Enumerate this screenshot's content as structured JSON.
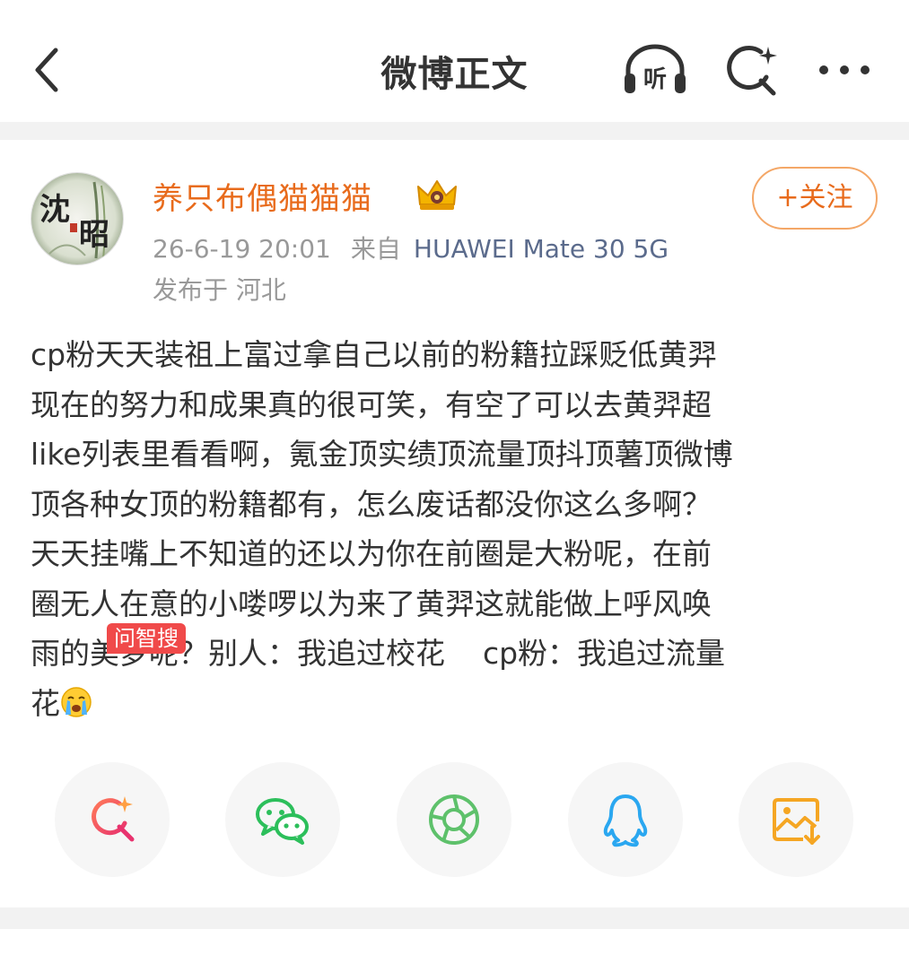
{
  "nav": {
    "title": "微博正文",
    "listen_label": "听",
    "icons": [
      "back-arrow-icon",
      "listen-headphones-icon",
      "ai-search-icon",
      "more-dots-icon"
    ]
  },
  "post": {
    "username": "养只布偶猫猫猫",
    "time": "26-6-19 20:01",
    "from_label": "来自",
    "device": "HUAWEI Mate 30 5G",
    "location": "发布于 河北",
    "follow_label": "+关注",
    "avatar_text": "沈 昭",
    "lines": [
      "cp粉天天装祖上富过拿自己以前的粉籍拉踩贬低黄羿",
      "现在的努力和成果真的很可笑，有空了可以去黄羿超",
      "like列表里看看啊，氪金顶实绩顶流量顶抖顶薯顶微博",
      "顶各种女顶的粉籍都有，怎么废话都没你这么多啊？",
      "天天挂嘴上不知道的还以为你在前圈是大粉呢，在前",
      "圈无人在意的小喽啰以为来了黄羿这就能做上呼风唤",
      "雨的美梦呢？别人：我追过校花    cp粉：我追过流量",
      "花"
    ]
  },
  "share": {
    "badge": "问智搜",
    "buttons": [
      "ai-search-share-icon",
      "wechat-icon",
      "moments-icon",
      "qq-icon",
      "save-image-icon"
    ]
  },
  "colors": {
    "username": "#e86b1c",
    "follow_border": "#f4a767",
    "device": "#5b6b8c",
    "badge": "#f04a4a",
    "divider": "#f2f2f2"
  }
}
